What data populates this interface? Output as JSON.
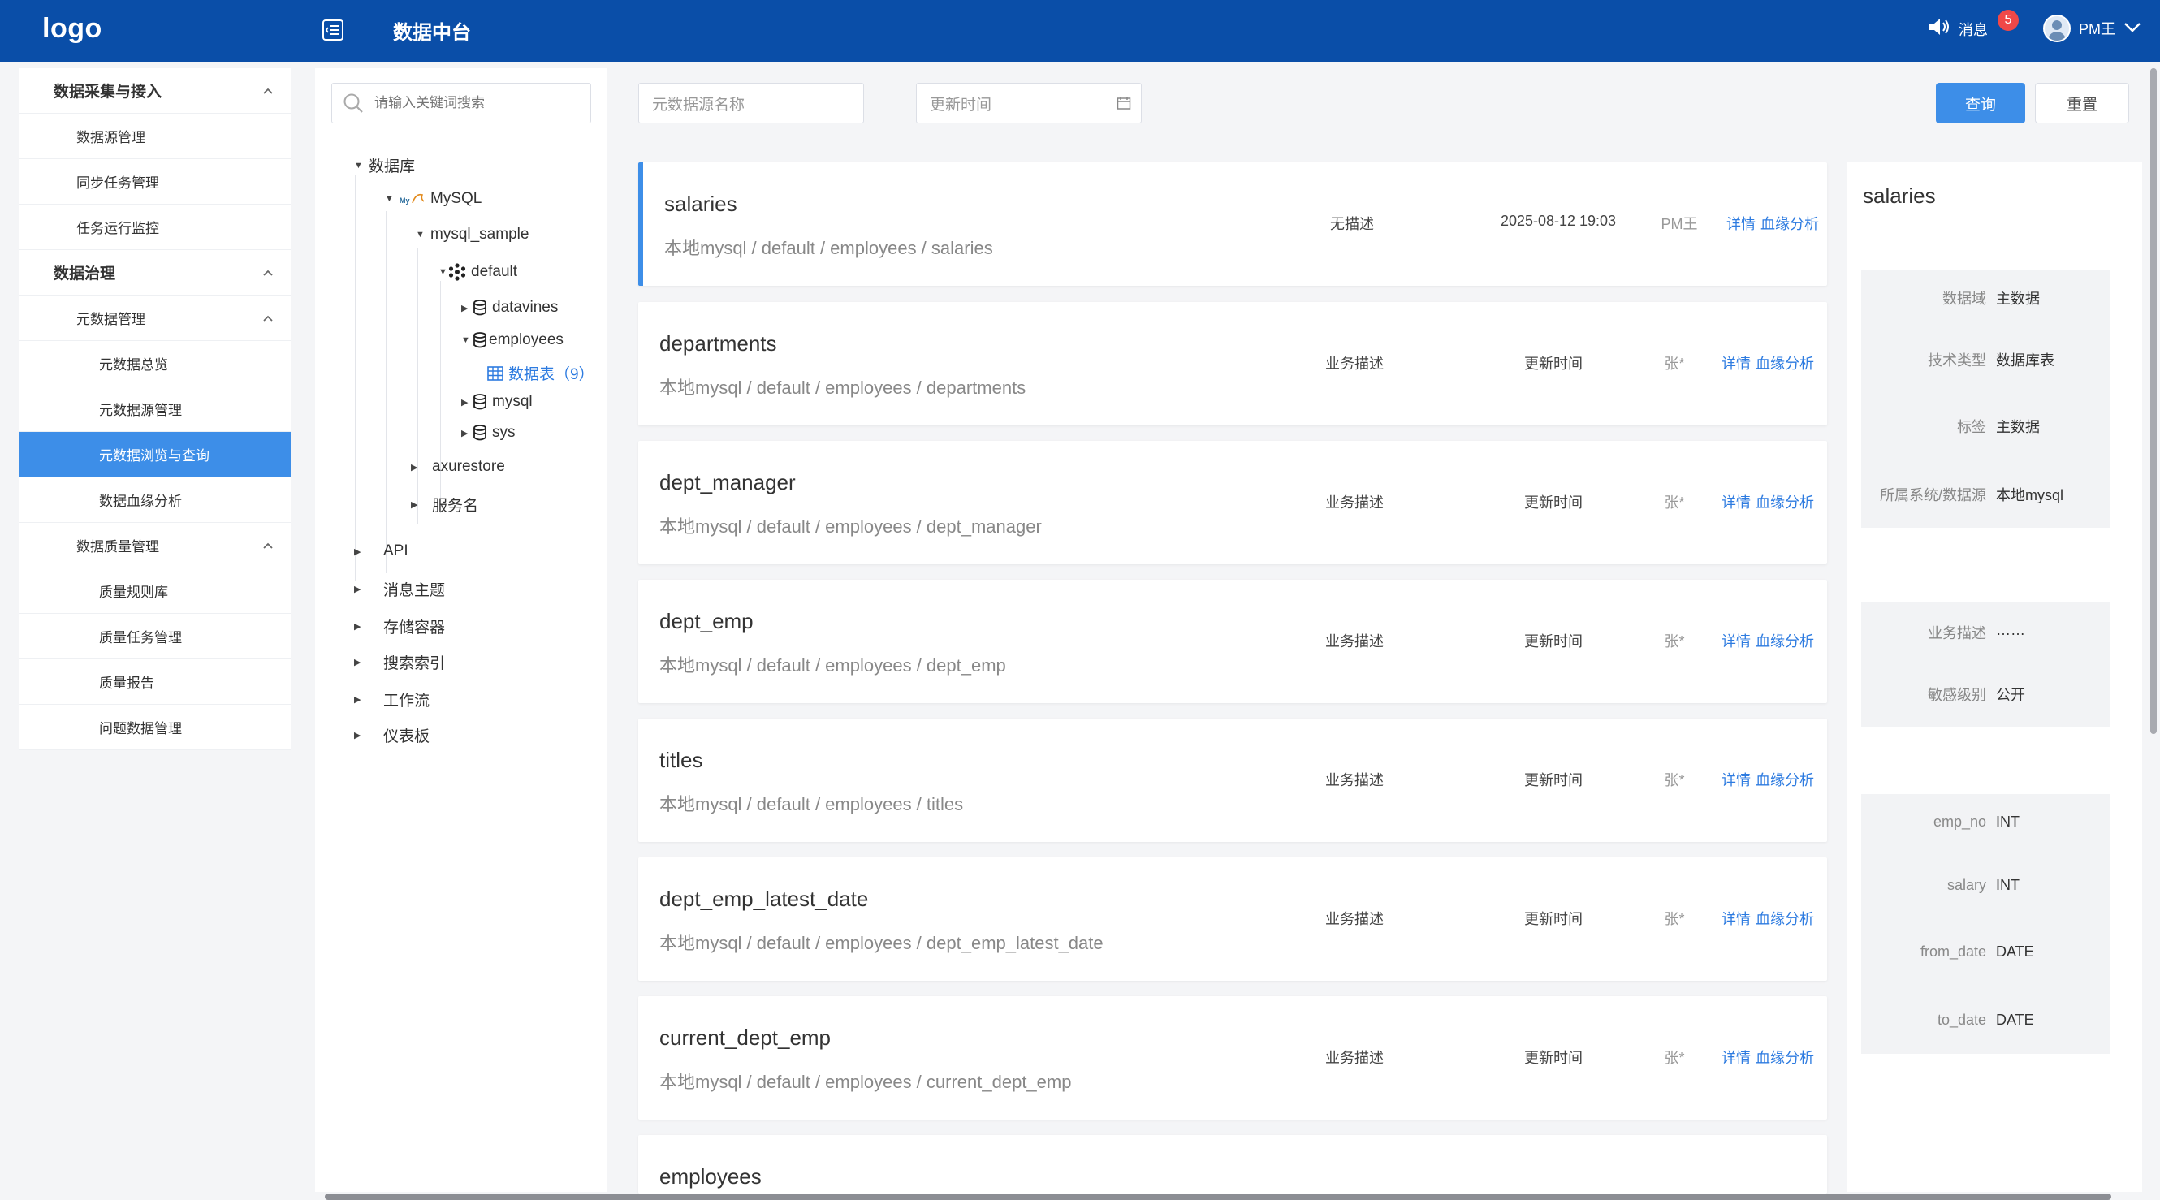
{
  "header": {
    "logo": "logo",
    "app_title": "数据中台",
    "message_label": "消息",
    "message_count": "5",
    "user_name": "PM王",
    "bg_color": "#0a4ea8"
  },
  "sidebar": {
    "items": [
      {
        "label": "数据采集与接入"
      },
      {
        "label": "数据源管理"
      },
      {
        "label": "同步任务管理"
      },
      {
        "label": "任务运行监控"
      },
      {
        "label": "数据治理"
      },
      {
        "label": "元数据管理"
      },
      {
        "label": "元数据总览"
      },
      {
        "label": "元数据源管理"
      },
      {
        "label": "元数据浏览与查询"
      },
      {
        "label": "数据血缘分析"
      },
      {
        "label": "数据质量管理"
      },
      {
        "label": "质量规则库"
      },
      {
        "label": "质量任务管理"
      },
      {
        "label": "质量报告"
      },
      {
        "label": "问题数据管理"
      }
    ]
  },
  "tree": {
    "search_placeholder": "请输入关键词搜索",
    "nodes": [
      {
        "label": "数据库"
      },
      {
        "label": "MySQL"
      },
      {
        "label": "mysql_sample"
      },
      {
        "label": "default"
      },
      {
        "label": "datavines"
      },
      {
        "label": "employees"
      },
      {
        "label": "数据表（9）"
      },
      {
        "label": "mysql"
      },
      {
        "label": "sys"
      },
      {
        "label": "axurestore"
      },
      {
        "label": "服务名"
      },
      {
        "label": "API"
      },
      {
        "label": "消息主题"
      },
      {
        "label": "存储容器"
      },
      {
        "label": "搜索索引"
      },
      {
        "label": "工作流"
      },
      {
        "label": "仪表板"
      }
    ]
  },
  "filters": {
    "name_placeholder": "元数据源名称",
    "time_placeholder": "更新时间",
    "query_label": "查询",
    "reset_label": "重置"
  },
  "list": {
    "detail_link": "详情",
    "lineage_link": "血缘分析",
    "items": [
      {
        "name": "salaries",
        "path": "本地mysql / default / employees / salaries",
        "desc": "无描述",
        "time": "2025-08-12 19:03",
        "owner": "PM王"
      },
      {
        "name": "departments",
        "path": "本地mysql / default / employees / departments",
        "desc": "业务描述",
        "time": "更新时间",
        "owner": "张*"
      },
      {
        "name": "dept_manager",
        "path": "本地mysql / default / employees / dept_manager",
        "desc": "业务描述",
        "time": "更新时间",
        "owner": "张*"
      },
      {
        "name": "dept_emp",
        "path": "本地mysql / default / employees / dept_emp",
        "desc": "业务描述",
        "time": "更新时间",
        "owner": "张*"
      },
      {
        "name": "titles",
        "path": "本地mysql / default / employees / titles",
        "desc": "业务描述",
        "time": "更新时间",
        "owner": "张*"
      },
      {
        "name": "dept_emp_latest_date",
        "path": "本地mysql / default / employees / dept_emp_latest_date",
        "desc": "业务描述",
        "time": "更新时间",
        "owner": "张*"
      },
      {
        "name": "current_dept_emp",
        "path": "本地mysql / default / employees / current_dept_emp",
        "desc": "业务描述",
        "time": "更新时间",
        "owner": "张*"
      },
      {
        "name": "employees",
        "path": "",
        "desc": "",
        "time": "",
        "owner": ""
      }
    ]
  },
  "detail": {
    "title": "salaries",
    "basic": [
      {
        "key": "数据域",
        "value": "主数据"
      },
      {
        "key": "技术类型",
        "value": "数据库表"
      },
      {
        "key": "标签",
        "value": "主数据"
      },
      {
        "key": "所属系统/数据源",
        "value": "本地mysql"
      }
    ],
    "business": [
      {
        "key": "业务描述",
        "value": "……"
      },
      {
        "key": "敏感级别",
        "value": "公开"
      }
    ],
    "columns": [
      {
        "key": "emp_no",
        "value": "INT"
      },
      {
        "key": "salary",
        "value": "INT"
      },
      {
        "key": "from_date",
        "value": "DATE"
      },
      {
        "key": "to_date",
        "value": "DATE"
      }
    ]
  }
}
